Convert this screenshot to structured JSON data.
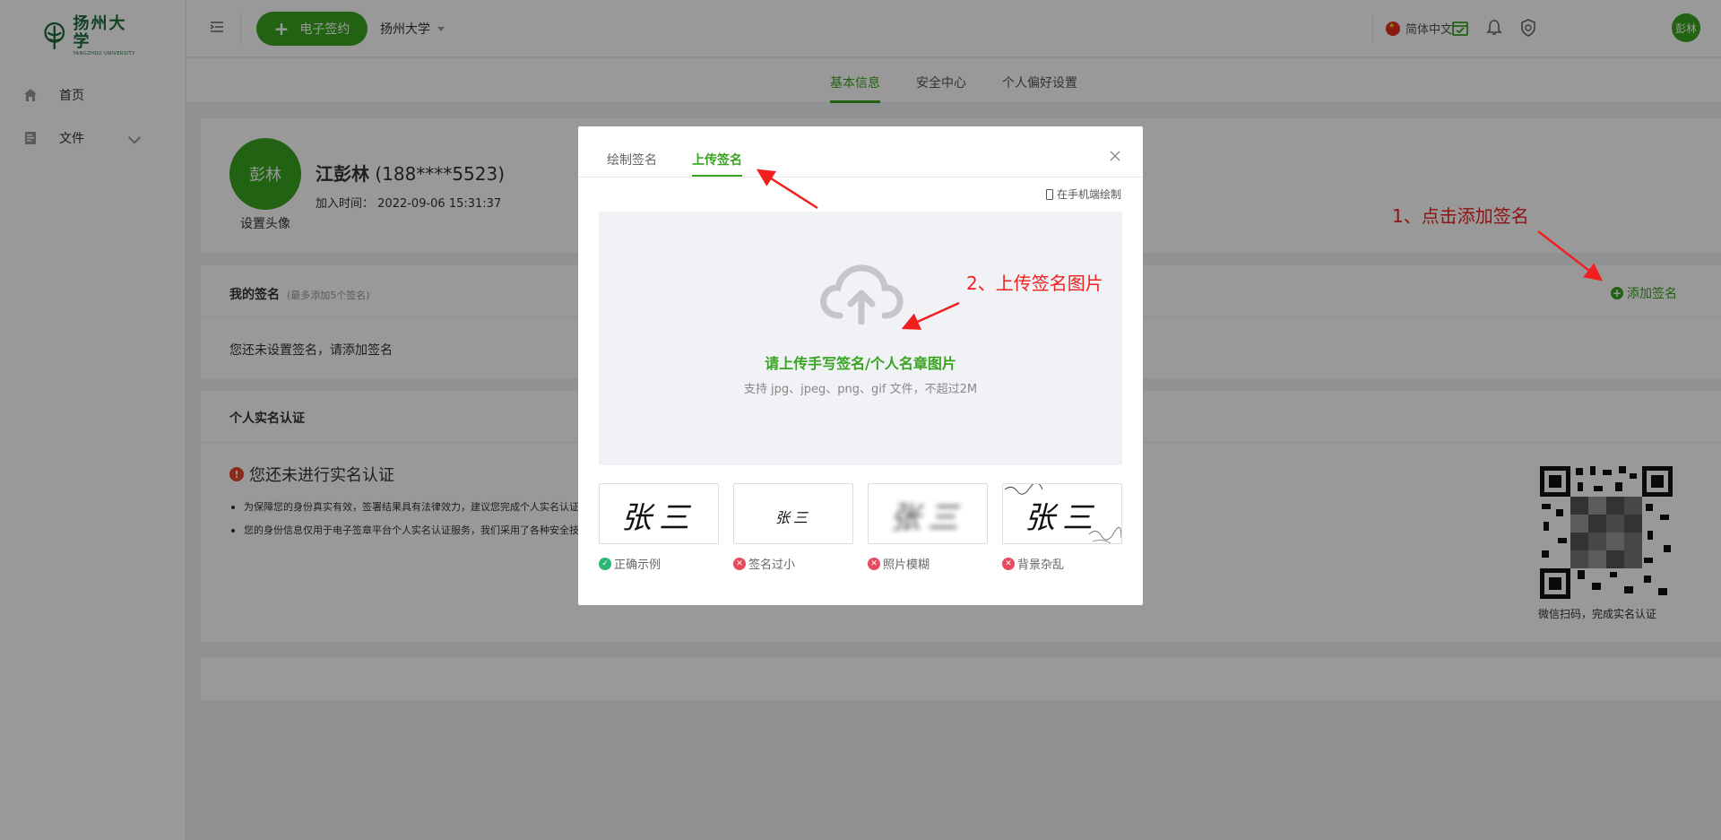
{
  "app": {
    "logo_cn": "扬州大学",
    "logo_en": "YANGZHOU UNIVERSITY"
  },
  "sidebar": {
    "items": [
      {
        "label": "首页",
        "icon": "home-icon"
      },
      {
        "label": "文件",
        "icon": "file-icon"
      }
    ]
  },
  "header": {
    "esign_label": "电子签约",
    "org": "扬州大学",
    "lang": "简体中文",
    "avatar_text": "彭林"
  },
  "tabs": [
    {
      "label": "基本信息",
      "active": true
    },
    {
      "label": "安全中心"
    },
    {
      "label": "个人偏好设置"
    }
  ],
  "profile": {
    "avatar_text": "彭林",
    "set_avatar": "设置头像",
    "name": "江彭林",
    "phone": "(188****5523)",
    "join_label": "加入时间：",
    "join_time": "2022-09-06 15:31:37"
  },
  "signatures": {
    "title": "我的签名",
    "hint": "(最多添加5个签名)",
    "add_label": "添加签名",
    "empty_text": "您还未设置签名，请添加签名"
  },
  "realname": {
    "title": "个人实名认证",
    "warning": "您还未进行实名认证",
    "bullets": [
      "为保障您的身份真实有效，签署结果具有法律效力，建议您完成个人实名认证",
      "您的身份信息仅用于电子签章平台个人实名认证服务，我们采用了各种安全技术保护您的信息"
    ],
    "qr_caption": "微信扫码，完成实名认证"
  },
  "modal": {
    "tabs": [
      {
        "label": "绘制签名"
      },
      {
        "label": "上传签名",
        "active": true
      }
    ],
    "phone_draw": "在手机端绘制",
    "upload_title": "请上传手写签名/个人名章图片",
    "upload_hint": "支持 jpg、jpeg、png、gif 文件，不超过2M",
    "samples": [
      {
        "label": "正确示例",
        "status": "ok",
        "sample_text": "张三"
      },
      {
        "label": "签名过小",
        "status": "bad",
        "sample_text": "张三"
      },
      {
        "label": "照片模糊",
        "status": "bad",
        "sample_text": "张三"
      },
      {
        "label": "背景杂乱",
        "status": "bad",
        "sample_text": "张三"
      }
    ]
  },
  "annotations": {
    "step1": "1、点击添加签名",
    "step2": "2、上传签名图片"
  },
  "colors": {
    "brand": "#39a321",
    "annotation": "#f21f1f",
    "overlay": "rgba(0,0,0,0.40)"
  }
}
